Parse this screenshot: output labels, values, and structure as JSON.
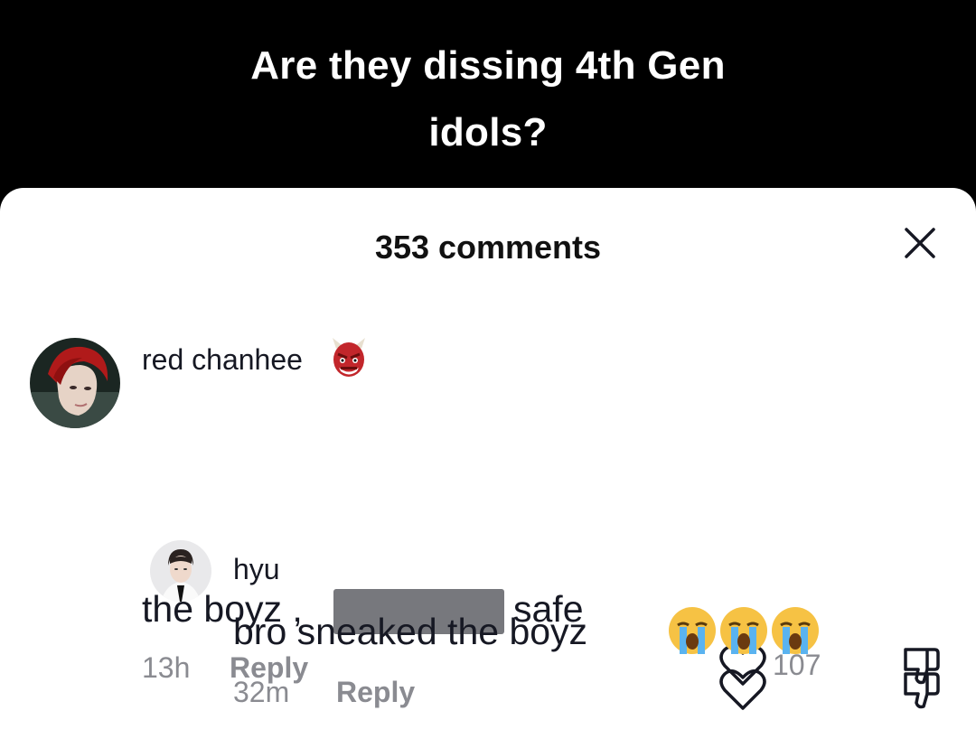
{
  "video": {
    "caption_line1": "Are they dissing 4th Gen",
    "caption_line2": "idols?"
  },
  "comments_sheet": {
    "title": "353 comments",
    "close_icon": "close-icon"
  },
  "comments": [
    {
      "username": "red chanhee",
      "username_emoji": "ogre-emoji",
      "text_before": "the boyz ,",
      "redacted": true,
      "text_after": "safe",
      "time": "13h",
      "reply_label": "Reply",
      "like_count": "107"
    }
  ],
  "replies": [
    {
      "username": "hyu",
      "text": "bro sneaked the boyz",
      "emojis": [
        "loudly-crying-face",
        "loudly-crying-face",
        "loudly-crying-face"
      ],
      "time": "32m",
      "reply_label": "Reply"
    }
  ],
  "colors": {
    "text": "#161823",
    "muted": "#8a8b91",
    "background": "#ffffff"
  }
}
